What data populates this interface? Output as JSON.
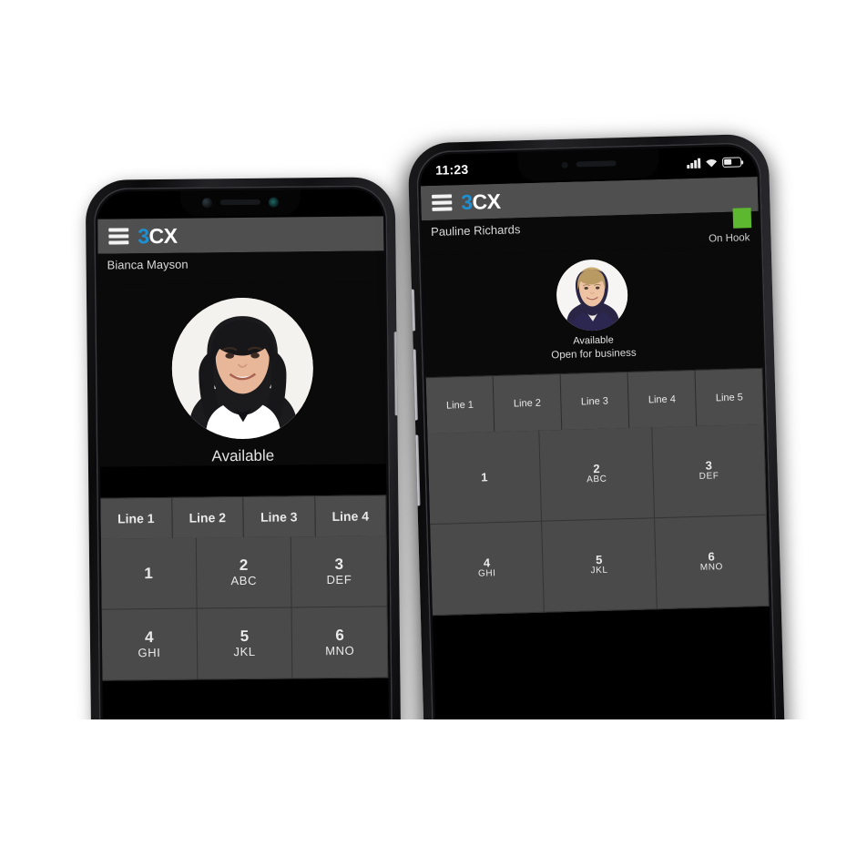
{
  "scene": {
    "background": "#ffffff",
    "description": "Two smartphones side by side showing the 3CX softphone app"
  },
  "brand": {
    "logo_prefix": "3",
    "logo_suffix": "CX",
    "accent_color": "#1e8fd1",
    "appbar_color": "#4f4f4f",
    "presence_color": "#5db830"
  },
  "phone_left": {
    "appbar": {
      "menu_icon": "hamburger-menu-icon",
      "logo_prefix": "3",
      "logo_suffix": "CX"
    },
    "user": {
      "name": "Bianca Mayson"
    },
    "profile": {
      "avatar": "woman-dark-hair-avatar",
      "status": "Available"
    },
    "lines": [
      "Line 1",
      "Line 2",
      "Line 3",
      "Line 4"
    ],
    "dialpad": [
      {
        "digit": "1",
        "letters": ""
      },
      {
        "digit": "2",
        "letters": "ABC"
      },
      {
        "digit": "3",
        "letters": "DEF"
      },
      {
        "digit": "4",
        "letters": "GHI"
      },
      {
        "digit": "5",
        "letters": "JKL"
      },
      {
        "digit": "6",
        "letters": "MNO"
      }
    ]
  },
  "phone_right": {
    "statusbar": {
      "time": "11:23",
      "signal_icon": "cellular-signal-icon",
      "wifi_icon": "wifi-icon",
      "battery_icon": "battery-icon"
    },
    "appbar": {
      "menu_icon": "hamburger-menu-icon",
      "logo_prefix": "3",
      "logo_suffix": "CX"
    },
    "user": {
      "name": "Pauline Richards",
      "hook_state": "On Hook",
      "presence_color": "#5db830"
    },
    "profile": {
      "avatar": "woman-blonde-hair-avatar",
      "status": "Available",
      "status_message": "Open for business"
    },
    "lines": [
      "Line 1",
      "Line 2",
      "Line 3",
      "Line 4",
      "Line 5"
    ],
    "dialpad": [
      {
        "digit": "1",
        "letters": ""
      },
      {
        "digit": "2",
        "letters": "ABC"
      },
      {
        "digit": "3",
        "letters": "DEF"
      },
      {
        "digit": "4",
        "letters": "GHI"
      },
      {
        "digit": "5",
        "letters": "JKL"
      },
      {
        "digit": "6",
        "letters": "MNO"
      }
    ]
  }
}
